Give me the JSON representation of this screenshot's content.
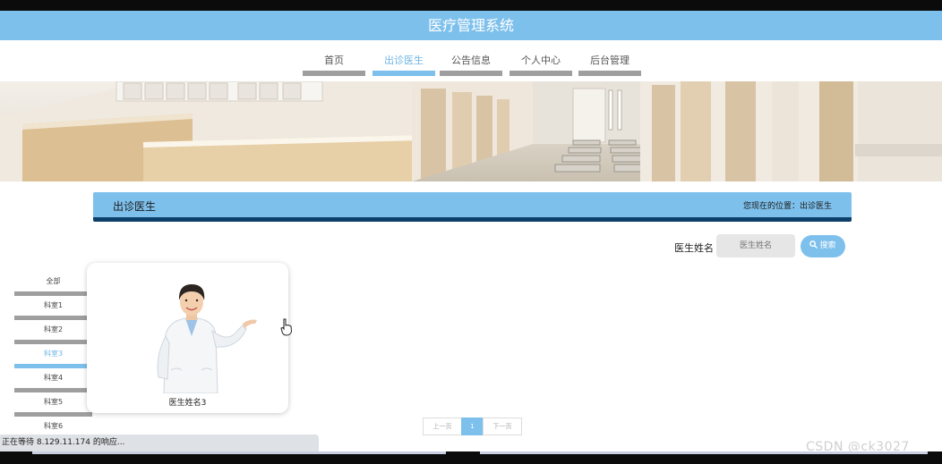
{
  "app": {
    "title": "医疗管理系统"
  },
  "nav": {
    "items": [
      {
        "label": "首页"
      },
      {
        "label": "出诊医生"
      },
      {
        "label": "公告信息"
      },
      {
        "label": "个人中心"
      },
      {
        "label": "后台管理"
      }
    ],
    "active_index": 1
  },
  "section": {
    "title": "出诊医生",
    "breadcrumb": "您现在的位置：出诊医生"
  },
  "search": {
    "label": "医生姓名",
    "placeholder": "医生姓名",
    "button_label": "搜索"
  },
  "sidebar": {
    "items": [
      {
        "label": "全部"
      },
      {
        "label": "科室1"
      },
      {
        "label": "科室2"
      },
      {
        "label": "科室3"
      },
      {
        "label": "科室4"
      },
      {
        "label": "科室5"
      },
      {
        "label": "科室6"
      }
    ],
    "active_index": 3
  },
  "doctors": [
    {
      "name": "医生姓名3"
    }
  ],
  "pagination": {
    "prev_label": "上一页",
    "current_page": "1",
    "next_label": "下一页"
  },
  "browser": {
    "status_text": "正在等待 8.129.11.174 的响应..."
  },
  "watermark": "CSDN @ck3027",
  "colors": {
    "accent": "#7ec0ec",
    "section_underline": "#0d3f6b",
    "inactive_bar": "#9e9e9e"
  }
}
